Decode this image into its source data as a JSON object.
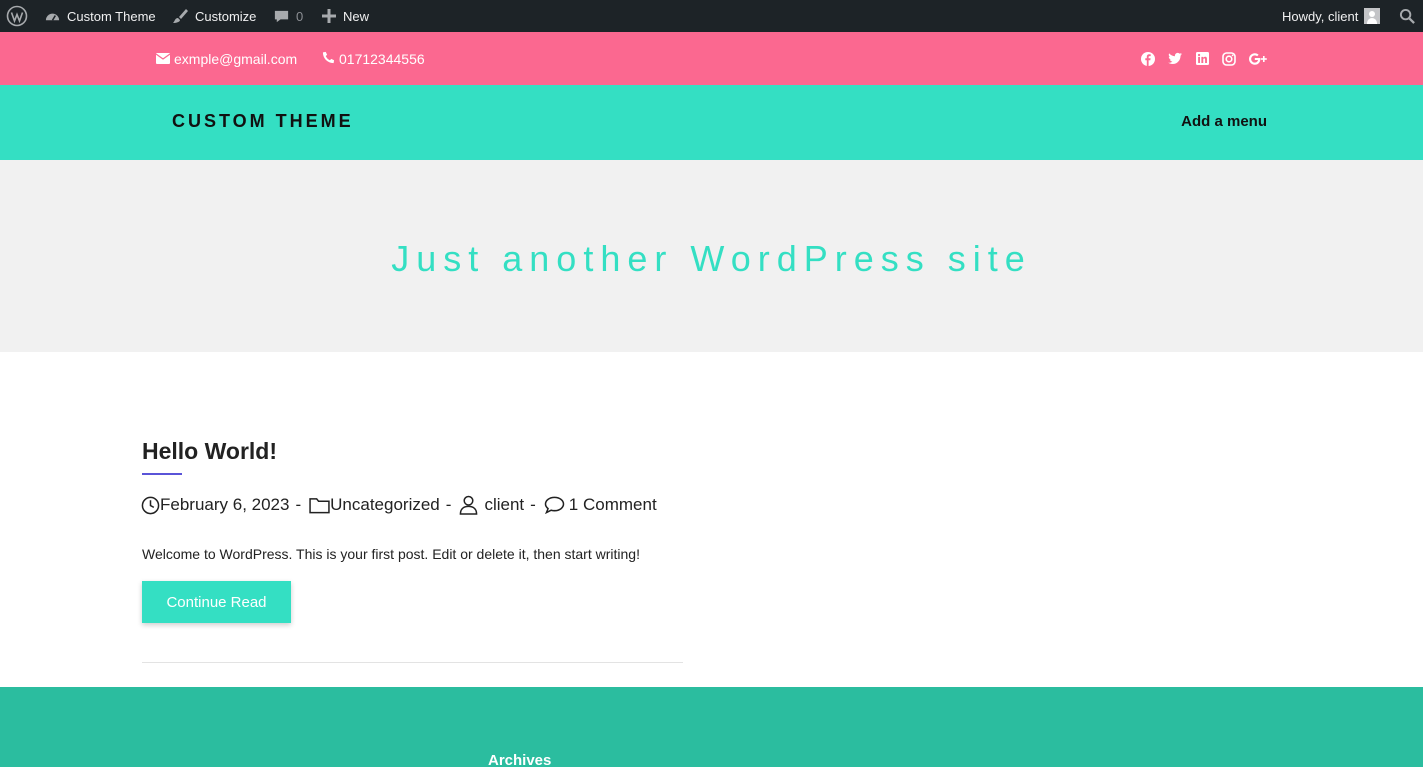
{
  "admin_bar": {
    "site_name": "Custom Theme",
    "customize": "Customize",
    "comments_count": "0",
    "new_label": "New",
    "greeting": "Howdy, client",
    "icons": [
      "wordpress-logo-icon",
      "dashboard-icon",
      "brush-icon",
      "comment-bubble-icon",
      "plus-icon",
      "avatar",
      "search-icon"
    ]
  },
  "topbar": {
    "email": "exmple@gmail.com",
    "phone": "01712344556",
    "social_icons": [
      "facebook-icon",
      "twitter-icon",
      "linkedin-icon",
      "instagram-icon",
      "google-plus-icon"
    ],
    "background": "#fb6890"
  },
  "header": {
    "site_title": "CUSTOM THEME",
    "menu_link": "Add a menu",
    "background": "#34dfc3"
  },
  "hero": {
    "tagline": "Just another WordPress site"
  },
  "post": {
    "title": "Hello World!",
    "date": "February 6, 2023",
    "category": "Uncategorized",
    "author": "client",
    "comments": "1 Comment",
    "separator": "-",
    "excerpt": "Welcome to WordPress. This is your first post. Edit or delete it, then start writing!",
    "continue_label": "Continue Read",
    "accent_underline": "#5a54d8"
  },
  "footer": {
    "widget_title": "Archives",
    "background": "#2bbd9f"
  }
}
